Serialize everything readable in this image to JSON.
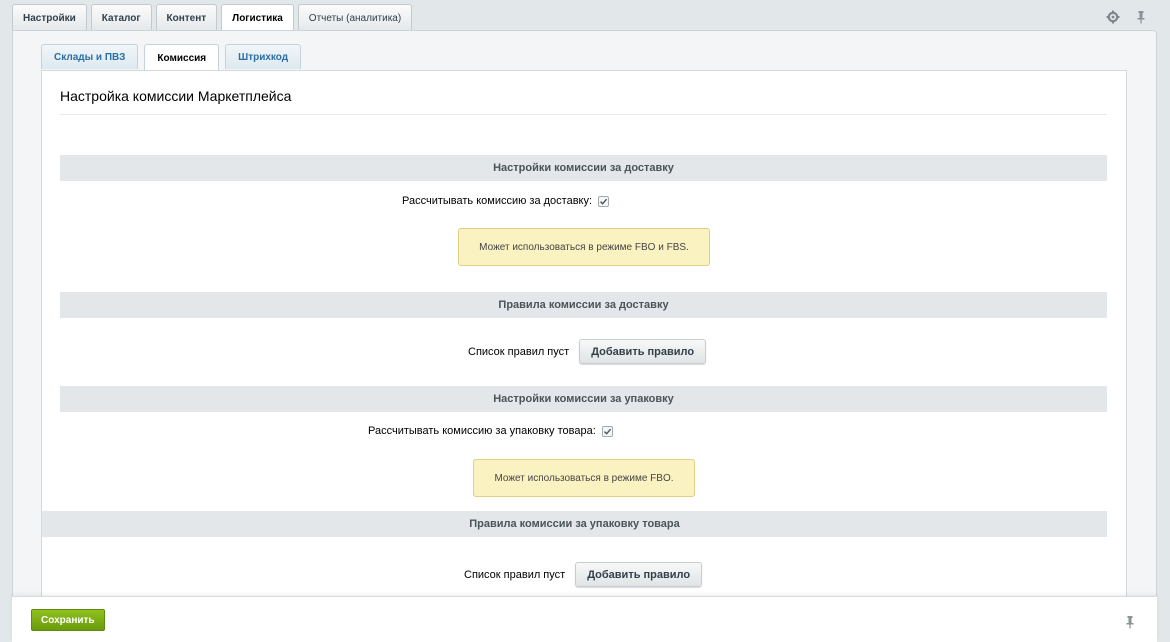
{
  "top_tabs": [
    {
      "label": "Настройки"
    },
    {
      "label": "Каталог"
    },
    {
      "label": "Контент"
    },
    {
      "label": "Логистика"
    },
    {
      "label": "Отчеты (аналитика)"
    }
  ],
  "top_icons": [
    "gear-icon",
    "pin-icon"
  ],
  "sub_tabs": [
    {
      "label": "Склады и ПВЗ"
    },
    {
      "label": "Комиссия"
    },
    {
      "label": "Штрихкод"
    }
  ],
  "content": {
    "title": "Настройка комиссии Маркетплейса",
    "delivery_settings": {
      "header": "Настройки комиссии за доставку",
      "checkbox_label": "Рассчитывать комиссию за доставку:",
      "checked": true,
      "note": "Может использоваться в режиме FBO и FBS."
    },
    "delivery_rules": {
      "header": "Правила комиссии за доставку",
      "empty_text": "Список правил пуст",
      "add_button": "Добавить правило"
    },
    "packaging_settings": {
      "header": "Настройки комиссии за упаковку",
      "checkbox_label": "Рассчитывать комиссию за упаковку товара:",
      "checked": true,
      "note": "Может использоваться в режиме FBO."
    },
    "packaging_rules": {
      "header": "Правила комиссии за упаковку товара",
      "empty_text": "Список правил пуст",
      "add_button": "Добавить правило"
    }
  },
  "footer": {
    "save_button": "Сохранить"
  },
  "colors": {
    "save_green": "#7aad14",
    "note_yellow": "#fbf2c1",
    "section_gray": "#e3e7e9",
    "tab_blue": "#2b6fa3"
  }
}
